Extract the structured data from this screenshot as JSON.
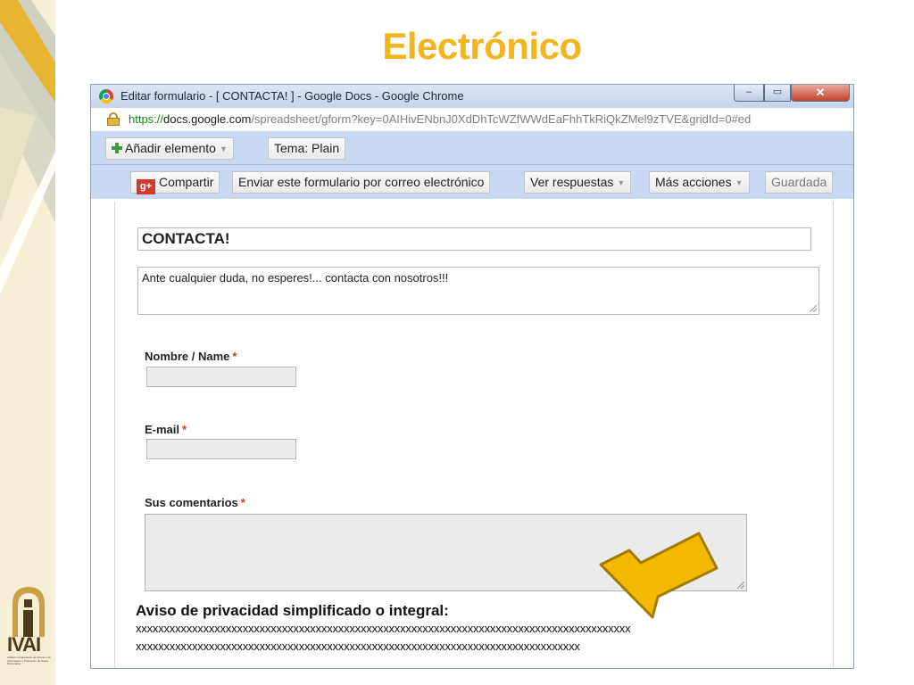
{
  "slide": {
    "title": "Electrónico",
    "accent_color": "#f2b51d",
    "logo_wordmark": "IVAI",
    "logo_small_text": "Instituto Veracruzano de Acceso a la Información y Protección de Datos Personales"
  },
  "window": {
    "title": "Editar formulario - [ CONTACTA! ] - Google Docs - Google Chrome",
    "url_scheme": "https://",
    "url_host": "docs.google.com",
    "url_path": "/spreadsheet/gform?key=0AIHivENbnJ0XdDhTcWZfWWdEaFhhTkRiQkZMel9zTVE&gridId=0#ed",
    "controls": {
      "minimize": "–",
      "maximize": "▭",
      "close": "✕"
    }
  },
  "toolbar": {
    "add_item": "Añadir elemento",
    "theme": "Tema: Plain",
    "share": "Compartir",
    "gplus_badge": "g+",
    "email_form": "Enviar este formulario por correo electrónico",
    "view_responses": "Ver respuestas",
    "more_actions": "Más acciones",
    "saved": "Guardada"
  },
  "form": {
    "title": "CONTACTA!",
    "description": "Ante cualquier duda, no esperes!... contacta con nosotros!!!",
    "required_mark": "*",
    "questions": [
      {
        "label": "Nombre / Name"
      },
      {
        "label": "E-mail"
      },
      {
        "label": "Sus comentarios"
      }
    ]
  },
  "privacy": {
    "title": "Aviso de privacidad simplificado o integral:",
    "line1": "xxxxxxxxxxxxxxxxxxxxxxxxxxxxxxxxxxxxxxxxxxxxxxxxxxxxxxxxxxxxxxxxxxxxxxxxxxxxxxxxxxxxxxxx",
    "line2": "xxxxxxxxxxxxxxxxxxxxxxxxxxxxxxxxxxxxxxxxxxxxxxxxxxxxxxxxxxxxxxxxxxxxxxxxxxxxxxx"
  },
  "icons": {
    "browser": "chrome-icon",
    "secure": "lock-icon",
    "add": "plus-icon",
    "share": "google-plus-icon",
    "dropdown": "caret-down-icon",
    "pointer": "arrow-icon"
  }
}
